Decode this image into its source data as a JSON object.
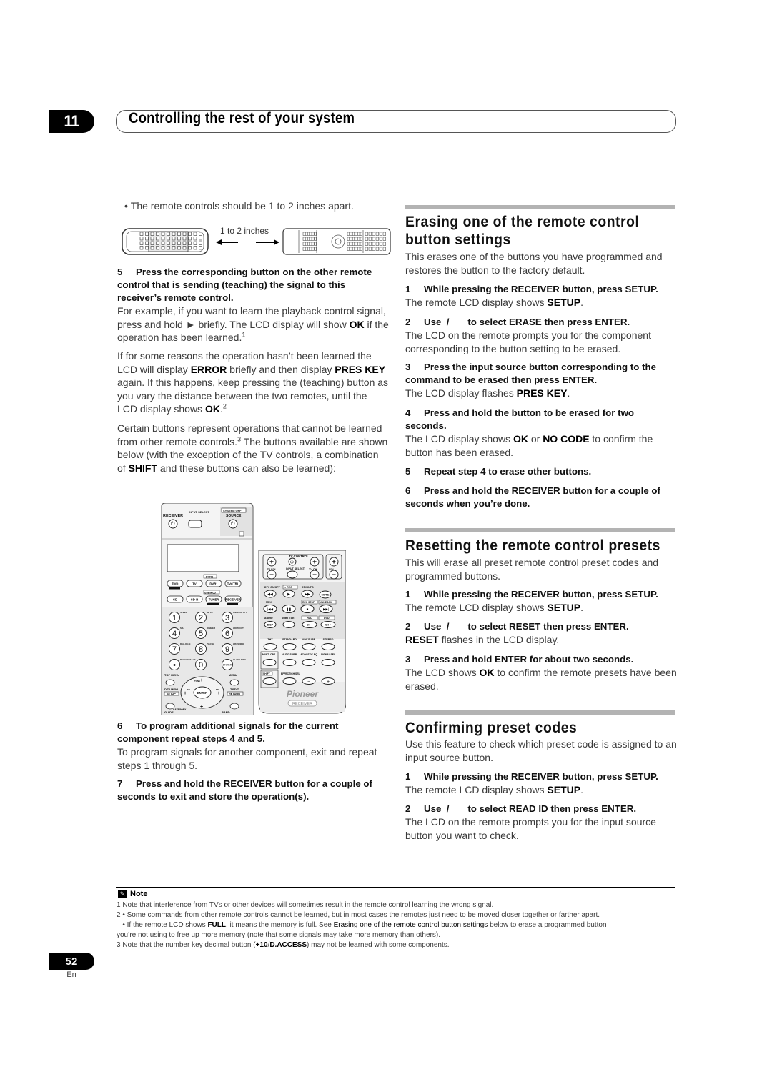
{
  "header": {
    "chapter_number": "11",
    "chapter_title": "Controlling the rest of your system"
  },
  "left_column": {
    "bullet": "The remote controls should be 1 to 2 inches apart.",
    "distance_label": "1 to 2 inches",
    "step5": {
      "number": "5",
      "title": "Press the corresponding button on the other remote control that is sending (teaching) the signal to this receiver’s remote control.",
      "p1_a": "For example, if you want to learn the playback control signal, press and hold ► briefly. The LCD display will show ",
      "p1_b": "OK",
      "p1_c": " if the operation has been learned.",
      "p1_sup": "1",
      "p2_a": "If for some reasons the operation hasn’t been learned the LCD will display ",
      "p2_b": "ERROR",
      "p2_c": " briefly and then display ",
      "p2_d": "PRES KEY",
      "p2_e": " again. If this happens, keep pressing the (teaching) button as you vary the distance between the two remotes, until the LCD display shows ",
      "p2_f": "OK",
      "p2_g": ".",
      "p2_sup": "2",
      "p3_a": "Certain buttons represent operations that cannot be learned from other remote controls.",
      "p3_sup": "3",
      "p3_b": " The buttons available are shown below (with the exception of the TV controls, a combination of ",
      "p3_c": "SHIFT",
      "p3_d": " and these buttons can also be learned):"
    },
    "step6": {
      "number": "6",
      "title": "To program additional signals for the current component repeat steps 4 and 5.",
      "body": "To program signals for another component, exit and repeat steps 1 through 5."
    },
    "step7": {
      "number": "7",
      "title": "Press and hold the RECEIVER button for a couple of seconds to exit and store the operation(s)."
    }
  },
  "remote_labels": {
    "receiver": "RECEIVER",
    "input_select": "INPUT SELECT",
    "system_off": "SYSTEM OFF",
    "source": "SOURCE",
    "dvr2": "DVR2",
    "dvd": "DVD",
    "tv": "TV",
    "dvr1": "DVR1",
    "tvctrl": "TVCTRL",
    "usb": "USB/IPOD",
    "cd": "CD",
    "cdr": "CD-R",
    "tuner": "TUNER",
    "receiver_btn": "RECEIVER",
    "keys": [
      "1",
      "2",
      "3",
      "4",
      "5",
      "6",
      "7",
      "8",
      "9",
      "•",
      "0",
      "ENTER"
    ],
    "key_subs": [
      "SLEEP",
      "SB ch",
      "ANALOG ATT",
      "SR+",
      "DIMMER",
      "HDMI OUT",
      "DIALOG E",
      "PHASE",
      "LISTENING",
      "D.ACCESS +10",
      "",
      "CLASS DISC"
    ],
    "top_menu": "TOP MENU",
    "menu": "MENU",
    "dtv_menu": "DTV MENU",
    "t_edit": "T.EDIT",
    "setup": "SETUP",
    "return": "RETURN",
    "guide": "GUIDE",
    "category": "CATEGORY",
    "band": "BAND",
    "enter": "ENTER",
    "tune": "TUNE",
    "st": "ST",
    "tv_control": "TV CONTROL",
    "tv_vol": "TV VOL",
    "tv_input": "INPUT SELECT",
    "tv_ch": "TV CH",
    "vol": "VOL",
    "dtv_onoff": "DTV ON/OFF",
    "rec": "REC",
    "dtv_info": "DTV INFO",
    "mute": "MUTE",
    "mpx": "MPX",
    "rec_stop": "REC STOP",
    "jukebox": "JUKEBOX",
    "audio": "AUDIO",
    "subtitle": "SUBTITLE",
    "hdd": "HDD",
    "dvd2": "DVD",
    "disp": "DISP",
    "ch_minus": "CH –",
    "ch_plus": "CH +",
    "thx": "THX",
    "standard": "STANDARD",
    "adv_surr": "ADV.SURR",
    "stereo": "STEREO",
    "multi_ope": "MULTI OPE",
    "auto_surr": "AUTO SURR",
    "acoustic_eq": "ACOUSTIC EQ",
    "signal_sel": "SIGNAL SEL",
    "shift": "SHIFT",
    "effect": "EFFECT/CH SEL",
    "brand": "Pioneer",
    "model": "RECEIVER"
  },
  "right_column": {
    "erase": {
      "title": "Erasing one of the remote control button settings",
      "intro": "This erases one of the buttons you have programmed and restores the button to the factory default.",
      "steps": [
        {
          "n": "1",
          "title": "While pressing the RECEIVER button, press SETUP.",
          "body_a": "The remote LCD display shows ",
          "body_b": "SETUP",
          "body_c": "."
        },
        {
          "n": "2",
          "title": "Use  /       to select ERASE then press ENTER.",
          "body_a": "The LCD on the remote prompts you for the component corresponding to the button setting to be erased.",
          "body_b": "",
          "body_c": ""
        },
        {
          "n": "3",
          "title": "Press the input source button corresponding to the command to be erased then press ENTER.",
          "body_a": "The LCD display flashes ",
          "body_b": "PRES KEY",
          "body_c": "."
        },
        {
          "n": "4",
          "title": "Press and hold the button to be erased for two seconds.",
          "body_a": "The LCD display shows ",
          "body_b": "OK",
          "body_c": " or ",
          "body_d": "NO CODE",
          "body_e": " to confirm the button has been erased."
        },
        {
          "n": "5",
          "title": "Repeat step 4 to erase other buttons."
        },
        {
          "n": "6",
          "title": "Press and hold the RECEIVER button for a couple of seconds when you’re done."
        }
      ]
    },
    "reset": {
      "title": "Resetting the remote control presets",
      "intro": "This will erase all preset remote control preset codes and programmed buttons.",
      "steps": [
        {
          "n": "1",
          "title": "While pressing the RECEIVER button, press SETUP.",
          "body_a": "The remote LCD display shows ",
          "body_b": "SETUP",
          "body_c": "."
        },
        {
          "n": "2",
          "title": "Use  /       to select RESET then press ENTER.",
          "body_a": "RESET",
          "body_b": " flashes in the LCD display."
        },
        {
          "n": "3",
          "title": "Press and hold ENTER for about two seconds.",
          "body_a": "The LCD shows ",
          "body_b": "OK",
          "body_c": " to confirm the remote presets have been erased."
        }
      ]
    },
    "confirm": {
      "title": "Confirming preset codes",
      "intro": "Use this feature to check which preset code is assigned to an input source button.",
      "steps": [
        {
          "n": "1",
          "title": "While pressing the RECEIVER button, press SETUP.",
          "body_a": "The remote LCD display shows ",
          "body_b": "SETUP",
          "body_c": "."
        },
        {
          "n": "2",
          "title": "Use  /       to select READ ID then press ENTER.",
          "body_a": "The LCD on the remote prompts you for the input source button you want to check."
        }
      ]
    }
  },
  "note": {
    "label": "Note",
    "icon": "pencil-icon",
    "line1": "1 Note that interference from TVs or other devices will sometimes result in the remote control learning the wrong signal.",
    "line2": "2 • Some commands from other remote controls cannot be learned, but in most cases the remotes just need to be moved closer together or farther apart.",
    "line3_a": "   • If the remote LCD shows ",
    "line3_b": "FULL",
    "line3_c": ", it means the memory is full. See ",
    "line3_d": "Erasing one of the remote control button settings",
    "line3_e": " below to erase a programmed button",
    "line4": "you’re not using to free up more memory (note that some signals may take more memory than others).",
    "line5_a": "3 Note that the number key decimal button (",
    "line5_b": "+10",
    "line5_c": "/",
    "line5_d": "D.ACCESS",
    "line5_e": ") may not be learned with some components."
  },
  "footer": {
    "page_number": "52",
    "language": "En"
  }
}
